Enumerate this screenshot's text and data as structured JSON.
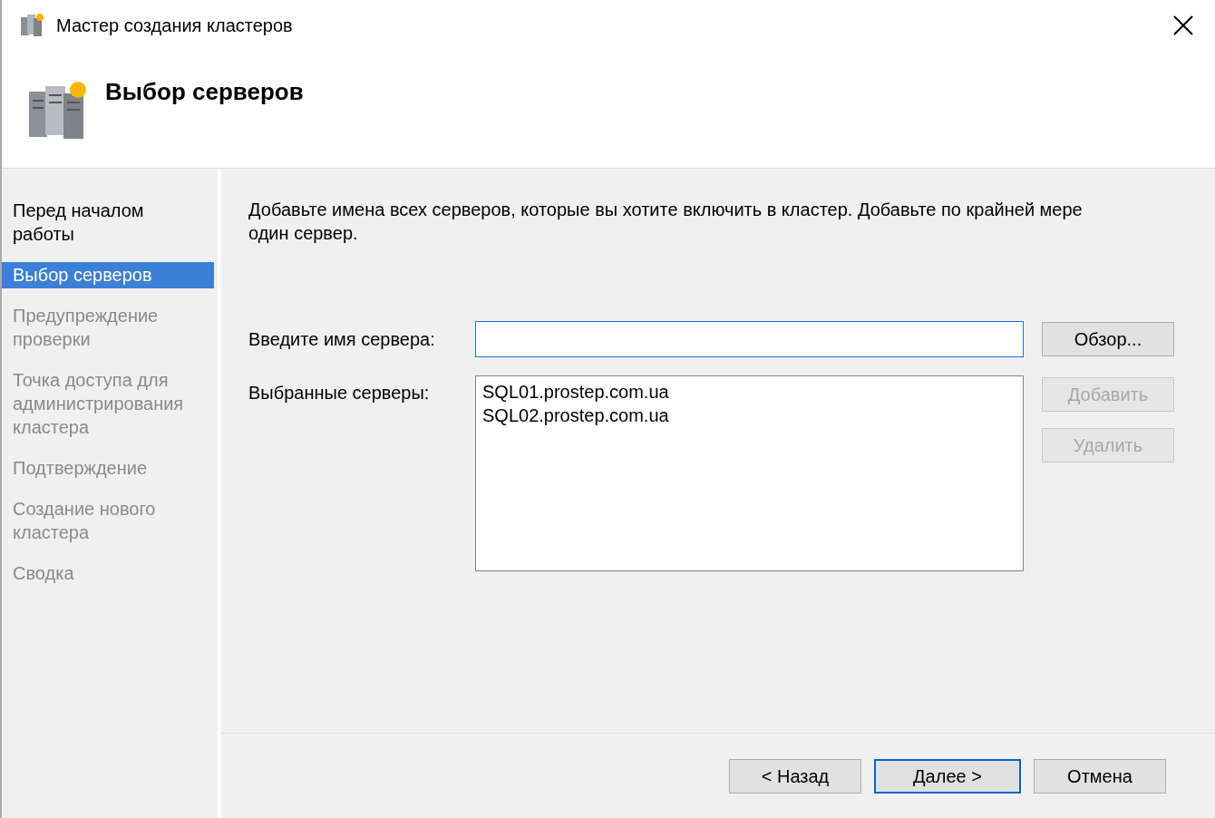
{
  "window": {
    "title": "Мастер создания кластеров"
  },
  "header": {
    "title": "Выбор серверов"
  },
  "steps": [
    {
      "label": "Перед началом работы",
      "selected": false,
      "disabled": false
    },
    {
      "label": "Выбор серверов",
      "selected": true,
      "disabled": false
    },
    {
      "label": "Предупреждение проверки",
      "selected": false,
      "disabled": true
    },
    {
      "label": "Точка доступа для администрирования кластера",
      "selected": false,
      "disabled": true
    },
    {
      "label": "Подтверждение",
      "selected": false,
      "disabled": true
    },
    {
      "label": "Создание нового кластера",
      "selected": false,
      "disabled": true
    },
    {
      "label": "Сводка",
      "selected": false,
      "disabled": true
    }
  ],
  "instructions": "Добавьте имена всех серверов, которые вы хотите включить в кластер. Добавьте по крайней мере один сервер.",
  "server_field": {
    "label": "Введите имя сервера:",
    "focused": true
  },
  "browse_button": {
    "label": "Обзор...",
    "disabled": false
  },
  "selected_servers": {
    "label": "Выбранные серверы:",
    "items": [
      "SQL01.prostep.com.ua",
      "SQL02.prostep.com.ua"
    ]
  },
  "list_buttons": [
    {
      "label": "Добавить",
      "disabled": true
    },
    {
      "label": "Удалить",
      "disabled": true
    }
  ],
  "footer_buttons": [
    {
      "label": "< Назад",
      "default": false
    },
    {
      "label": "Далее >",
      "default": true
    },
    {
      "label": "Отмена",
      "default": false
    }
  ]
}
